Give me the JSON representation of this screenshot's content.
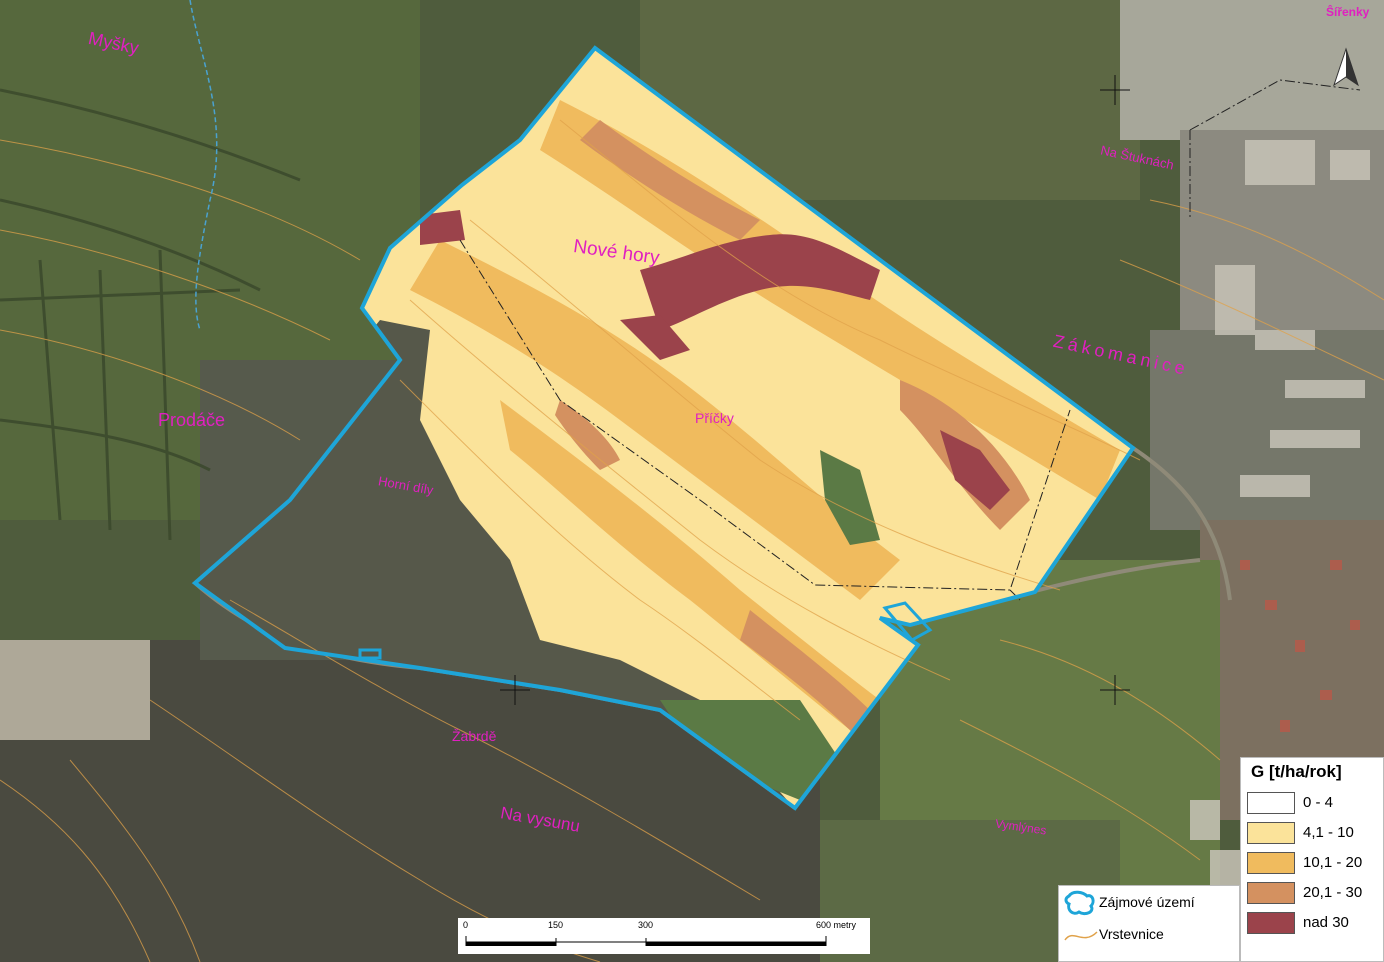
{
  "places": {
    "mysky": "Myšky",
    "prodace": "Prodáče",
    "nove_hory": "Nové hory",
    "pricky": "Příčky",
    "horni_diry": "Horní díly",
    "zabrde": "Žabrdě",
    "na_vysuni": "Na vysunu",
    "zakomanice": "Zákomanice",
    "na_stuknach": "Na Štuknách",
    "sirenky": "Ŝířenky",
    "v_mihes": "Vymlýnes"
  },
  "legend_g": {
    "title": "G [t/ha/rok]",
    "classes": [
      {
        "label": "0 - 4",
        "color": "#ffffff"
      },
      {
        "label": "4,1 - 10",
        "color": "#fbe39a"
      },
      {
        "label": "10,1 - 20",
        "color": "#f0bb5e"
      },
      {
        "label": "20,1 - 30",
        "color": "#d49160"
      },
      {
        "label": "nad 30",
        "color": "#9b434b"
      }
    ]
  },
  "legend_boundary": {
    "area_label": "Zájmové území",
    "area_color": "#1ea5d8",
    "contour_label": "Vrstevnice",
    "contour_color": "#e0a24a"
  },
  "scalebar": {
    "ticks": [
      "0",
      "150",
      "300",
      "600 metry"
    ]
  }
}
